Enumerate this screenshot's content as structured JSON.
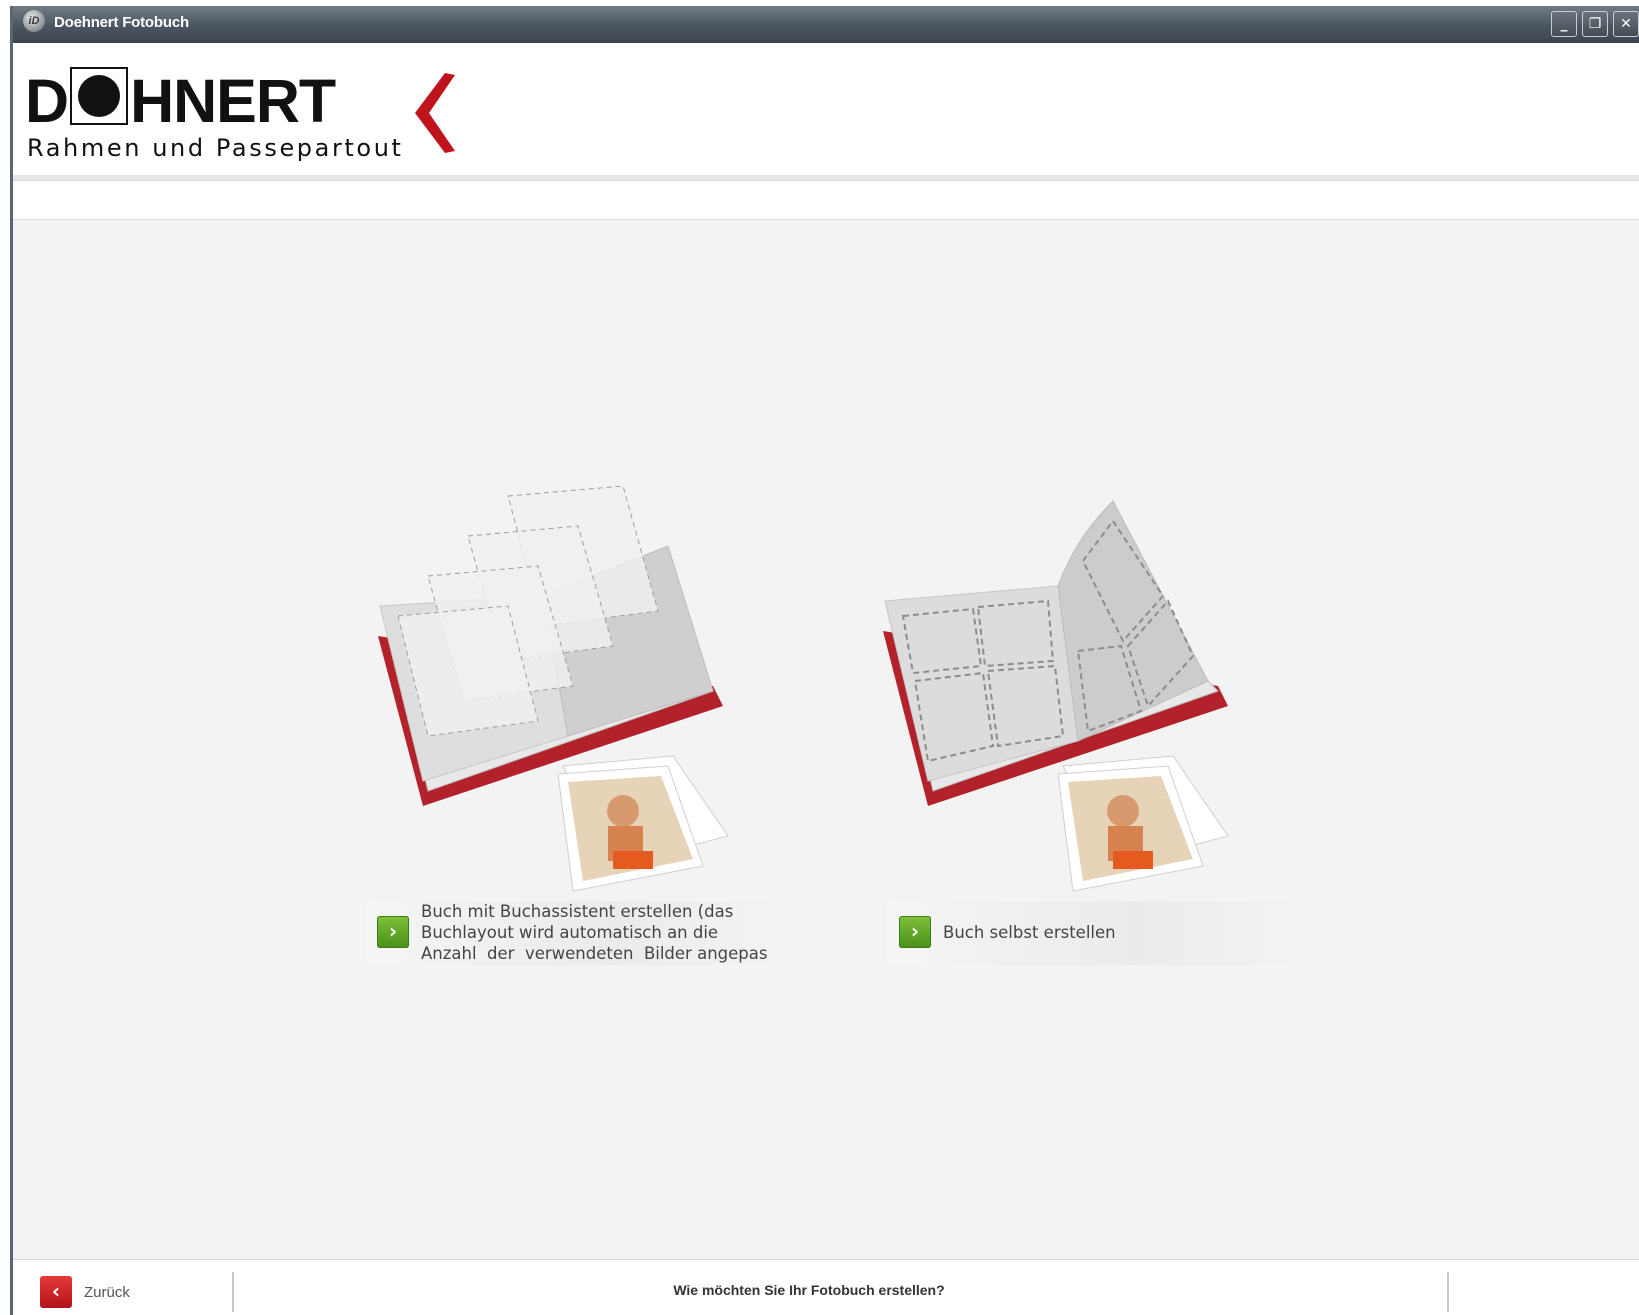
{
  "window": {
    "title": "Doehnert Fotobuch",
    "controls": {
      "minimize": "_",
      "restore": "❐",
      "close": "✕"
    }
  },
  "header": {
    "logo_word": "D",
    "logo_word_rest": "HNERT",
    "logo_subtitle": "Rahmen und Passepartout",
    "brand_color": "#c0141c"
  },
  "options": [
    {
      "label": "Buch mit Buchassistent erstellen (das\nBuchlayout wird automatisch an die\nAnzahl  der  verwendeten  Bilder angepas",
      "arrow": "›"
    },
    {
      "label": "Buch selbst erstellen",
      "arrow": "›"
    }
  ],
  "footer": {
    "back_label": "Zurück",
    "back_icon": "‹",
    "question": "Wie möchten Sie Ihr Fotobuch erstellen?"
  },
  "colors": {
    "accent_green": "#5aa323",
    "accent_red": "#c0141c",
    "background": "#f3f3f3"
  }
}
